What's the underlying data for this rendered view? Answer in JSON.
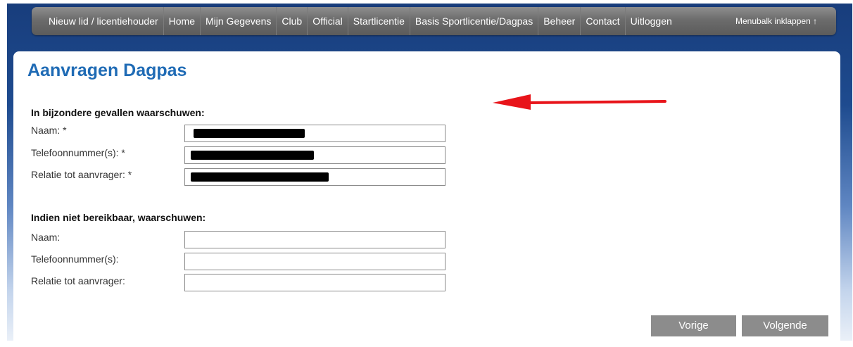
{
  "nav": {
    "items": [
      "Nieuw lid / licentiehouder",
      "Home",
      "Mijn Gegevens",
      "Club",
      "Official",
      "Startlicentie",
      "Basis Sportlicentie/Dagpas",
      "Beheer",
      "Contact",
      "Uitloggen"
    ],
    "collapse_label": "Menubalk inklappen ↑"
  },
  "page": {
    "title": "Aanvragen Dagpas"
  },
  "section1": {
    "heading": "In bijzondere gevallen waarschuwen:",
    "fields": [
      {
        "label": "Naam: *",
        "value": ""
      },
      {
        "label": "Telefoonnummer(s): *",
        "value": ""
      },
      {
        "label": "Relatie tot aanvrager: *",
        "value": ""
      }
    ]
  },
  "section2": {
    "heading": "Indien niet bereikbaar, waarschuwen:",
    "fields": [
      {
        "label": "Naam:",
        "value": ""
      },
      {
        "label": "Telefoonnummer(s):",
        "value": ""
      },
      {
        "label": "Relatie tot aanvrager:",
        "value": ""
      }
    ]
  },
  "buttons": {
    "prev": "Vorige",
    "next": "Volgende"
  },
  "colors": {
    "title": "#1f6bb5",
    "annotation_arrow": "#e8141a",
    "button": "#8c8c8c"
  }
}
